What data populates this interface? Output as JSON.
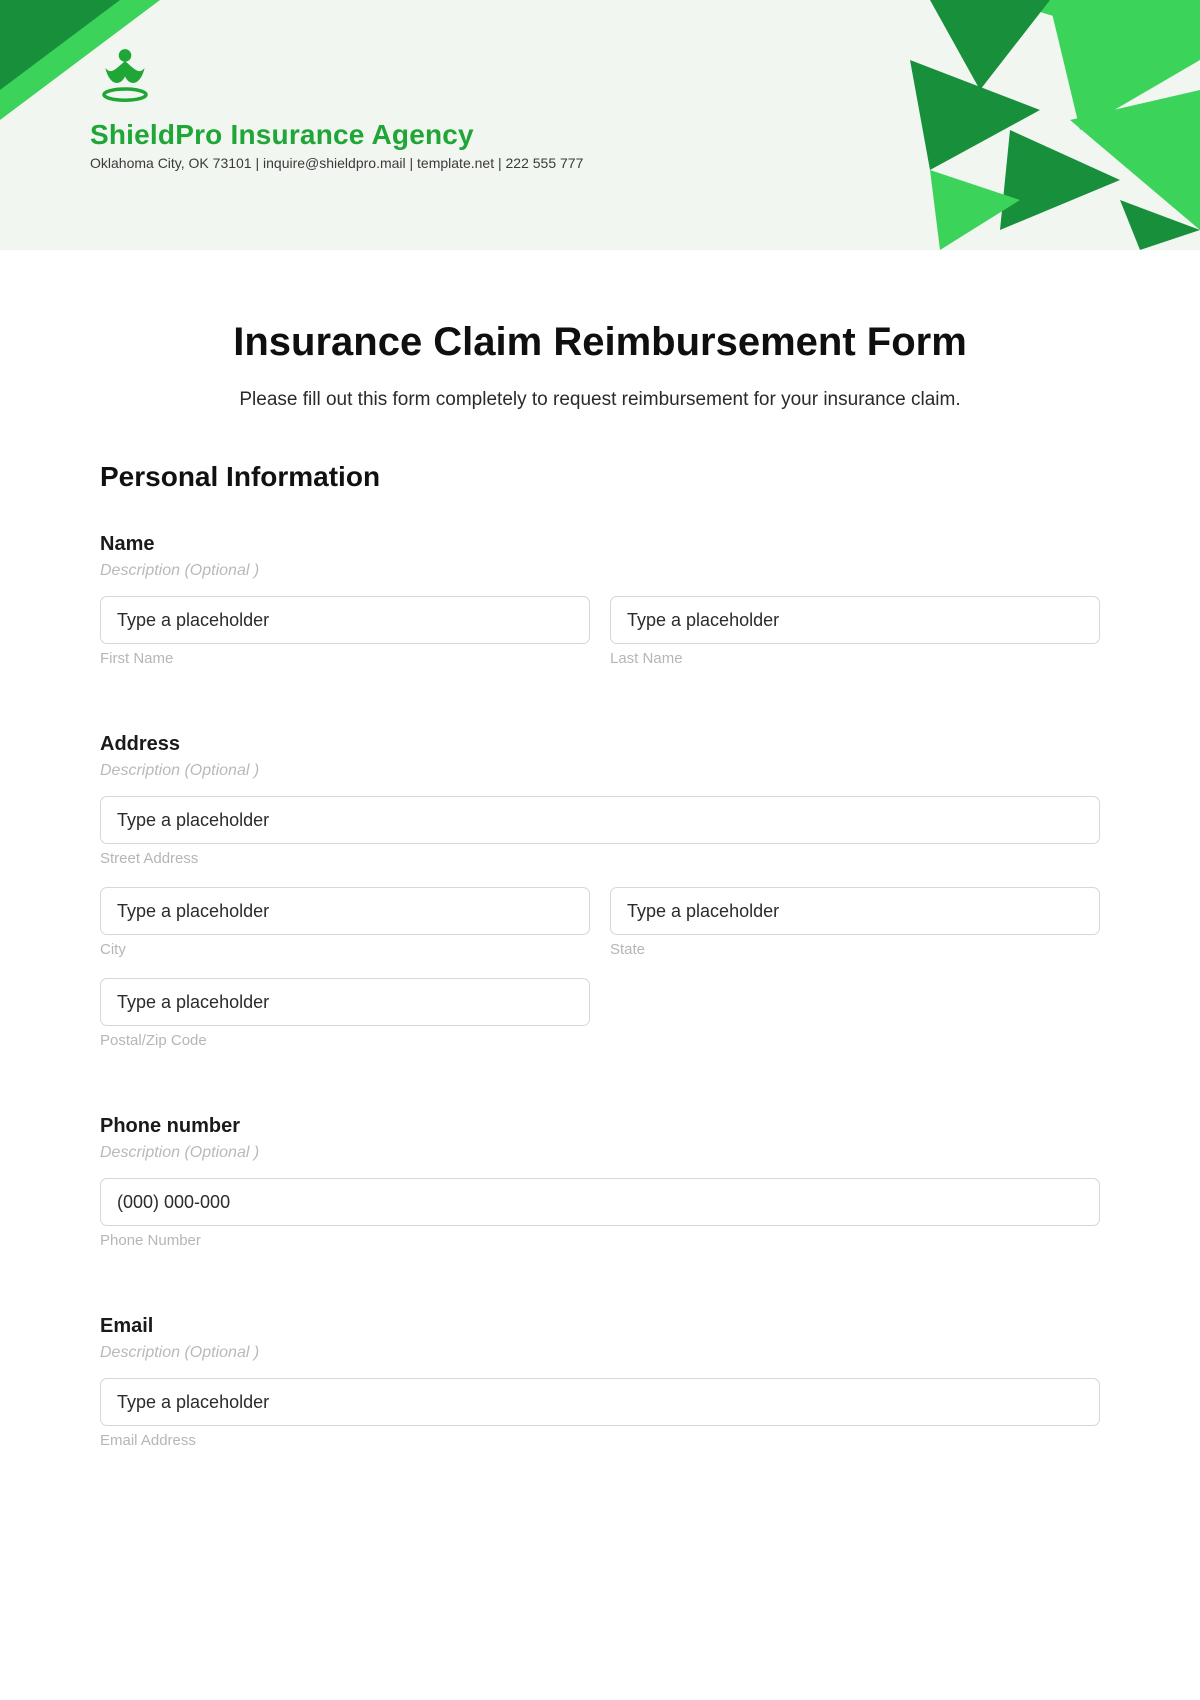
{
  "header": {
    "company_name": "ShieldPro Insurance Agency",
    "meta": "Oklahoma City, OK 73101 | inquire@shieldpro.mail | template.net | 222 555 777",
    "accent_dark": "#188f3a",
    "accent_light": "#3cd35a"
  },
  "form": {
    "title": "Insurance Claim Reimbursement Form",
    "intro": "Please fill out this form completely to request reimbursement for your insurance claim.",
    "section_personal": "Personal Information",
    "desc_optional": "Description  (Optional )",
    "name": {
      "label": "Name",
      "first_placeholder": "Type a placeholder",
      "first_sub": "First Name",
      "last_placeholder": "Type a placeholder",
      "last_sub": "Last Name"
    },
    "address": {
      "label": "Address",
      "street_placeholder": "Type a placeholder",
      "street_sub": "Street Address",
      "city_placeholder": "Type a placeholder",
      "city_sub": "City",
      "state_placeholder": "Type a placeholder",
      "state_sub": "State",
      "zip_placeholder": "Type a placeholder",
      "zip_sub": "Postal/Zip Code"
    },
    "phone": {
      "label": "Phone number",
      "placeholder": "(000) 000-000",
      "sub": "Phone Number"
    },
    "email": {
      "label": "Email",
      "placeholder": "Type a placeholder",
      "sub": "Email Address"
    }
  }
}
